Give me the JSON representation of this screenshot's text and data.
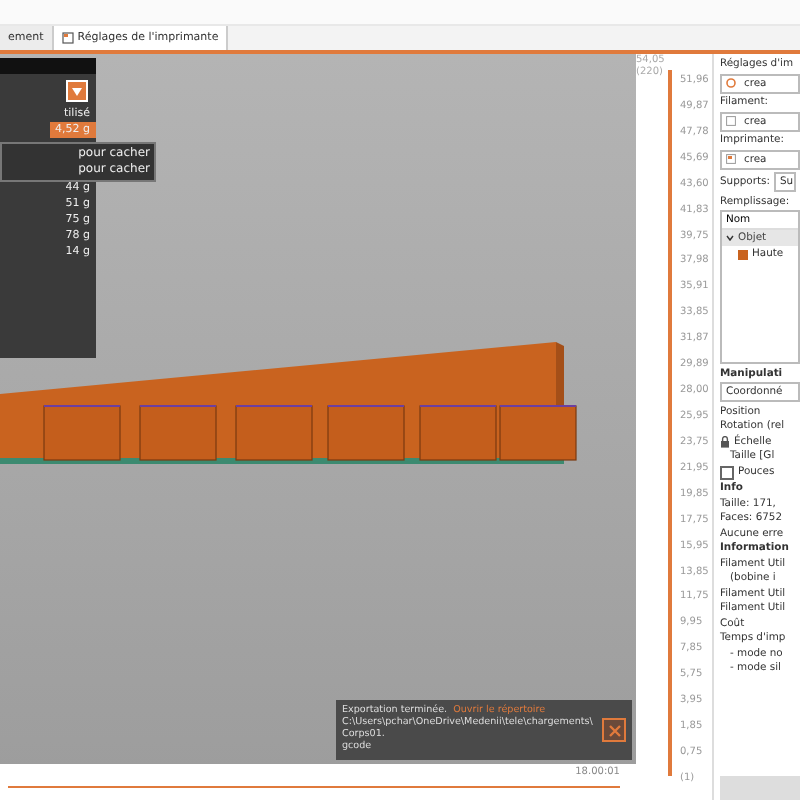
{
  "tabs": [
    {
      "label": "ement",
      "selected": false
    },
    {
      "label": "Réglages de l'imprimante",
      "selected": true
    }
  ],
  "legend": {
    "header": "tilisé",
    "items": [
      {
        "label": "4,52 g",
        "selected": true
      },
      {
        "label": "44 g",
        "selected": false
      },
      {
        "label": "51 g",
        "selected": false
      },
      {
        "label": "75 g",
        "selected": false
      },
      {
        "label": "78 g",
        "selected": false
      },
      {
        "label": "14 g",
        "selected": false
      }
    ]
  },
  "tooltip": [
    "pour cacher",
    "pour cacher"
  ],
  "vertical_slider": {
    "top_label": "54,05",
    "top_count": "(220)",
    "level": 1,
    "labels": [
      "51,96",
      "49,87",
      "47,78",
      "45,69",
      "43,60",
      "41,83",
      "39,75",
      "37,98",
      "35,91",
      "33,85",
      "31,87",
      "29,89",
      "28,00",
      "25,95",
      "23,75",
      "21,95",
      "19,85",
      "17,75",
      "15,95",
      "13,85",
      "11,75",
      "9,95",
      "7,85",
      "5,75",
      "3,95",
      "1,85",
      "0,75",
      "(1)"
    ]
  },
  "horizontal_slider": {
    "level": 1,
    "label": "18.00:01"
  },
  "notification": {
    "title": "Exportation terminée.",
    "link": "Ouvrir le répertoire",
    "path": [
      "C:\\Users\\pchar\\OneDrive\\Medenii\\tele\\chargements\\Corps01.",
      "gcode"
    ]
  },
  "panel": {
    "settings_label": "Réglages d'im",
    "print_value": "crea",
    "filament_label": "Filament:",
    "filament_value": "crea",
    "printer_label": "Imprimante:",
    "printer_value": "crea",
    "supports_label": "Supports:",
    "supports_value": "Su",
    "infill_label": "Remplissage:",
    "list_header": "Nom",
    "objects": [
      {
        "name": "Objet",
        "expanded": true,
        "children": [
          {
            "name": "Haute"
          }
        ]
      }
    ],
    "manip_title": "Manipulati",
    "coord_value": "Coordonné",
    "rows": [
      {
        "kind": "text",
        "label": "Position"
      },
      {
        "kind": "text",
        "label": "Rotation (rel"
      },
      {
        "kind": "lock",
        "label": "Échelle"
      },
      {
        "kind": "indent",
        "label": "Taille [Gl"
      },
      {
        "kind": "check",
        "label": "Pouces",
        "checked": false
      }
    ],
    "info_title": "Info",
    "info": [
      "Taille: 171,",
      "Faces: 6752",
      "Aucune erre"
    ],
    "stats_title": "Information",
    "stats": [
      {
        "kind": "text",
        "label": "Filament Util"
      },
      {
        "kind": "indent",
        "label": "(bobine i"
      },
      {
        "kind": "text",
        "label": "Filament Util"
      },
      {
        "kind": "text",
        "label": "Filament Util"
      },
      {
        "kind": "text",
        "label": "Coût"
      },
      {
        "kind": "text",
        "label": "Temps d'imp"
      },
      {
        "kind": "indent",
        "label": "- mode no"
      },
      {
        "kind": "indent",
        "label": "- mode sil"
      }
    ]
  }
}
